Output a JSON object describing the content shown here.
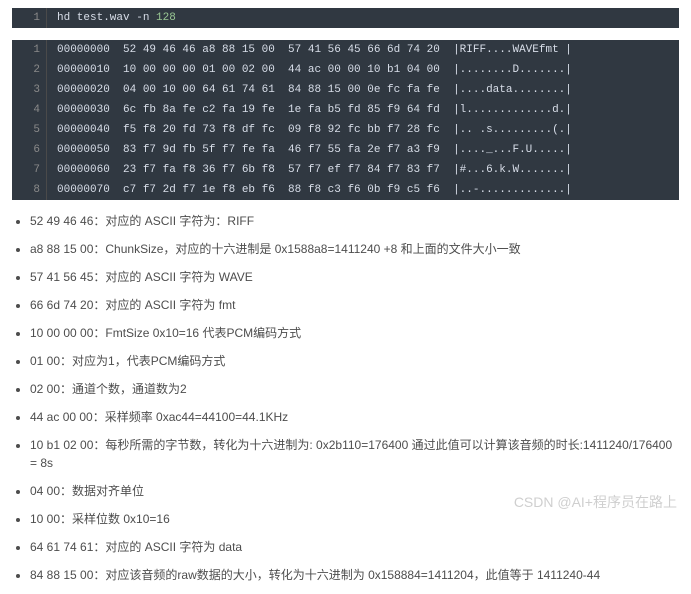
{
  "cmd_block": {
    "lines": [
      {
        "num": "1",
        "cmd": "hd test.wav ",
        "flag": "-n ",
        "arg": "128"
      }
    ]
  },
  "hex_block": {
    "lines": [
      {
        "num": "1",
        "addr": "00000000",
        "hex1": "52 49 46 46 a8 88 15 00",
        "hex2": "57 41 56 45 66 6d 74 20",
        "ascii": "|RIFF....WAVEfmt |"
      },
      {
        "num": "2",
        "addr": "00000010",
        "hex1": "10 00 00 00 01 00 02 00",
        "hex2": "44 ac 00 00 10 b1 04 00",
        "ascii": "|........D.......|"
      },
      {
        "num": "3",
        "addr": "00000020",
        "hex1": "04 00 10 00 64 61 74 61",
        "hex2": "84 88 15 00 0e fc fa fe",
        "ascii": "|....data........|"
      },
      {
        "num": "4",
        "addr": "00000030",
        "hex1": "6c fb 8a fe c2 fa 19 fe",
        "hex2": "1e fa b5 fd 85 f9 64 fd",
        "ascii": "|l.............d.|"
      },
      {
        "num": "5",
        "addr": "00000040",
        "hex1": "f5 f8 20 fd 73 f8 df fc",
        "hex2": "09 f8 92 fc bb f7 28 fc",
        "ascii": "|.. .s.........(.|"
      },
      {
        "num": "6",
        "addr": "00000050",
        "hex1": "83 f7 9d fb 5f f7 fe fa",
        "hex2": "46 f7 55 fa 2e f7 a3 f9",
        "ascii": "|...._...F.U.....|"
      },
      {
        "num": "7",
        "addr": "00000060",
        "hex1": "23 f7 fa f8 36 f7 6b f8",
        "hex2": "57 f7 ef f7 84 f7 83 f7",
        "ascii": "|#...6.k.W.......|"
      },
      {
        "num": "8",
        "addr": "00000070",
        "hex1": "c7 f7 2d f7 1e f8 eb f6",
        "hex2": "88 f8 c3 f6 0b f9 c5 f6",
        "ascii": "|..-.............|"
      }
    ]
  },
  "explanations": [
    "52 49 46 46：对应的 ASCII 字符为：RIFF",
    "a8 88 15 00：ChunkSize，对应的十六进制是 0x1588a8=1411240 +8 和上面的文件大小一致",
    "57 41 56 45：对应的 ASCII 字符为 WAVE",
    "66 6d 74 20：对应的 ASCII 字符为 fmt",
    "10 00 00 00：FmtSize 0x10=16 代表PCM编码方式",
    "01 00：对应为1，代表PCM编码方式",
    "02 00：通道个数，通道数为2",
    "44 ac 00 00：采样频率 0xac44=44100=44.1KHz",
    "10 b1 02 00：每秒所需的字节数，转化为十六进制为: 0x2b110=176400 通过此值可以计算该音频的时长:1411240/176400 = 8s",
    "04 00：数据对齐单位",
    "10 00：采样位数 0x10=16",
    "64 61 74 61：对应的 ASCII 字符为 data",
    "84 88 15 00：对应该音频的raw数据的大小，转化为十六进制为 0x158884=1411204，此值等于 1411240-44"
  ],
  "watermark": "CSDN @AI+程序员在路上"
}
